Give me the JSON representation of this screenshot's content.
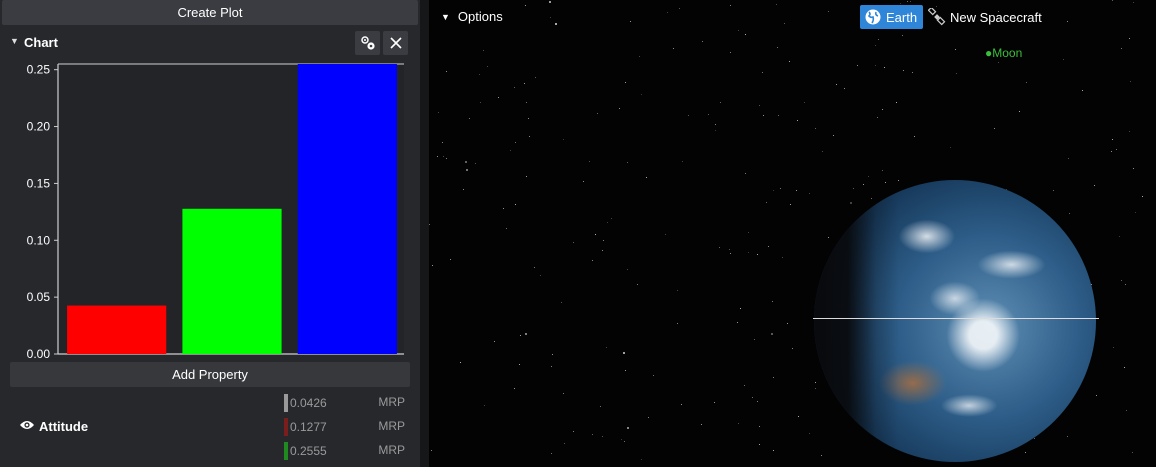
{
  "left_panel": {
    "create_plot_label": "Create Plot",
    "chart_header": {
      "title": "Chart",
      "gear_icon": "gears-icon",
      "close_icon": "close-icon"
    },
    "add_property_label": "Add Property",
    "property": {
      "name": "Attitude",
      "icon": "eye-icon",
      "values": [
        {
          "value": "0.0426",
          "unit": "MRP",
          "color": "#9a9a9a"
        },
        {
          "value": "0.1277",
          "unit": "MRP",
          "color": "#7a1d1d"
        },
        {
          "value": "0.2555",
          "unit": "MRP",
          "color": "#1f8a1f"
        }
      ]
    }
  },
  "chart_data": {
    "type": "bar",
    "categories": [
      "",
      "",
      ""
    ],
    "values": [
      0.0426,
      0.1277,
      0.2555
    ],
    "colors": [
      "#ff0000",
      "#00ff00",
      "#0000ff"
    ],
    "ylim": [
      0,
      0.255
    ],
    "yticks": [
      "0.00",
      "0.05",
      "0.10",
      "0.15",
      "0.20",
      "0.25"
    ],
    "ytick_values": [
      0,
      0.05,
      0.1,
      0.15,
      0.2,
      0.25
    ],
    "title": "",
    "xlabel": "",
    "ylabel": "",
    "grid": false
  },
  "scene": {
    "options_label": "Options",
    "earth_button_label": "Earth",
    "earth_icon": "globe-icon",
    "spacecraft_label": "New Spacecraft",
    "spacecraft_icon": "satellite-icon",
    "moon_label": "Moon",
    "moon_color": "#3bbf3b",
    "accent": "#2f86d8"
  }
}
